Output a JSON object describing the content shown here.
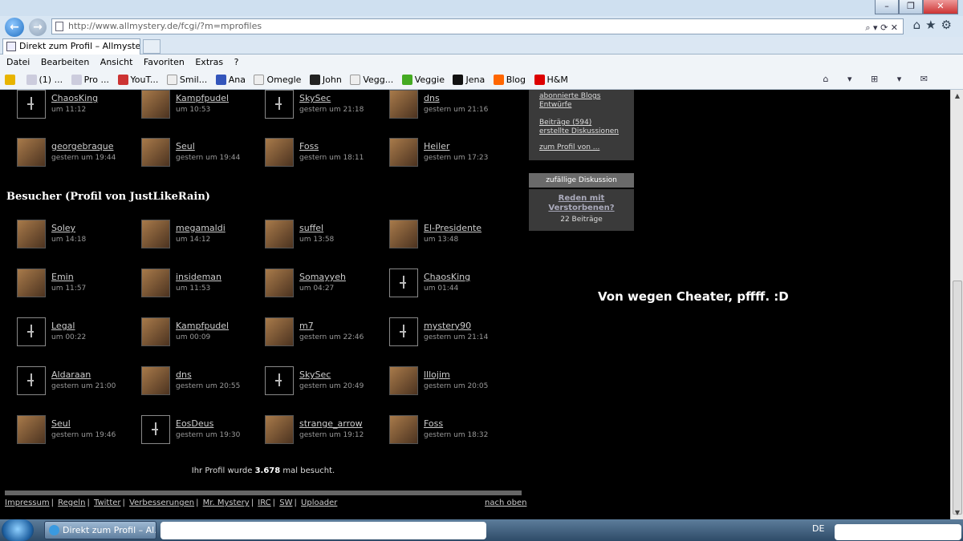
{
  "browser": {
    "url": "http://www.allmystery.de/fcgi/?m=mprofiles",
    "tab_title": "Direkt zum Profil – Allmyste...",
    "menu": [
      "Datei",
      "Bearbeiten",
      "Ansicht",
      "Favoriten",
      "Extras",
      "?"
    ],
    "favorites": [
      "(1) ...",
      "Pro ...",
      "YouT...",
      "Smil...",
      "Ana",
      "Omegle",
      "John",
      "Vegg...",
      "Veggie",
      "Jena",
      "Blog",
      "H&M"
    ]
  },
  "top_users": [
    {
      "name": "ChaosKing",
      "time": "um 11:12",
      "avatar": "default"
    },
    {
      "name": "Kampfpudel",
      "time": "um 10:53",
      "avatar": "image"
    },
    {
      "name": "SkySec",
      "time": "gestern um 21:18",
      "avatar": "default"
    },
    {
      "name": "dns",
      "time": "gestern um 21:16",
      "avatar": "image"
    },
    {
      "name": "georgebraque",
      "time": "gestern um 19:44",
      "avatar": "image"
    },
    {
      "name": "Seul",
      "time": "gestern um 19:44",
      "avatar": "image"
    },
    {
      "name": "Foss",
      "time": "gestern um 18:11",
      "avatar": "image"
    },
    {
      "name": "Heiler",
      "time": "gestern um 17:23",
      "avatar": "image"
    }
  ],
  "visitors_heading": "Besucher (Profil von JustLikeRain)",
  "visitors": [
    {
      "name": "Soley",
      "time": "um 14:18",
      "avatar": "image"
    },
    {
      "name": "megamaldi",
      "time": "um 14:12",
      "avatar": "image"
    },
    {
      "name": "suffel",
      "time": "um 13:58",
      "avatar": "image"
    },
    {
      "name": "El-Presidente",
      "time": "um 13:48",
      "avatar": "image"
    },
    {
      "name": "Emin",
      "time": "um 11:57",
      "avatar": "image"
    },
    {
      "name": "insideman",
      "time": "um 11:53",
      "avatar": "image"
    },
    {
      "name": "Somayyeh",
      "time": "um 04:27",
      "avatar": "image"
    },
    {
      "name": "ChaosKing",
      "time": "um 01:44",
      "avatar": "default"
    },
    {
      "name": "Legal",
      "time": "um 00:22",
      "avatar": "default"
    },
    {
      "name": "Kampfpudel",
      "time": "um 00:09",
      "avatar": "image"
    },
    {
      "name": "m7",
      "time": "gestern um 22:46",
      "avatar": "image"
    },
    {
      "name": "mystery90",
      "time": "gestern um 21:14",
      "avatar": "default"
    },
    {
      "name": "Aldaraan",
      "time": "gestern um 21:00",
      "avatar": "default"
    },
    {
      "name": "dns",
      "time": "gestern um 20:55",
      "avatar": "image"
    },
    {
      "name": "SkySec",
      "time": "gestern um 20:49",
      "avatar": "default"
    },
    {
      "name": "lllojim",
      "time": "gestern um 20:05",
      "avatar": "image"
    },
    {
      "name": "Seul",
      "time": "gestern um 19:46",
      "avatar": "image"
    },
    {
      "name": "EosDeus",
      "time": "gestern um 19:30",
      "avatar": "default"
    },
    {
      "name": "strange_arrow",
      "time": "gestern um 19:12",
      "avatar": "image"
    },
    {
      "name": "Foss",
      "time": "gestern um 18:32",
      "avatar": "image"
    }
  ],
  "visits": {
    "prefix": "Ihr Profil wurde",
    "count": "3.678",
    "suffix": "mal besucht."
  },
  "footer": {
    "links": [
      "Impressum",
      "Regeln",
      "Twitter",
      "Verbesserungen",
      "Mr. Mystery",
      "IRC",
      "SW",
      "Uploader"
    ],
    "top_link": "nach oben"
  },
  "sidebar": {
    "links": [
      "abonnierte Blogs",
      "Entwürfe",
      "Beiträge (594)",
      "erstellte Diskussionen",
      "zum Profil von ..."
    ],
    "random_header": "zufällige Diskussion",
    "random_title_1": "Reden mit",
    "random_title_2": "Verstorbenen?",
    "random_count": "22 Beiträge"
  },
  "overlay_text": "Von wegen Cheater, pffff. :D",
  "taskbar": {
    "window_label": "Direkt zum Profil – Al...",
    "language": "DE"
  }
}
